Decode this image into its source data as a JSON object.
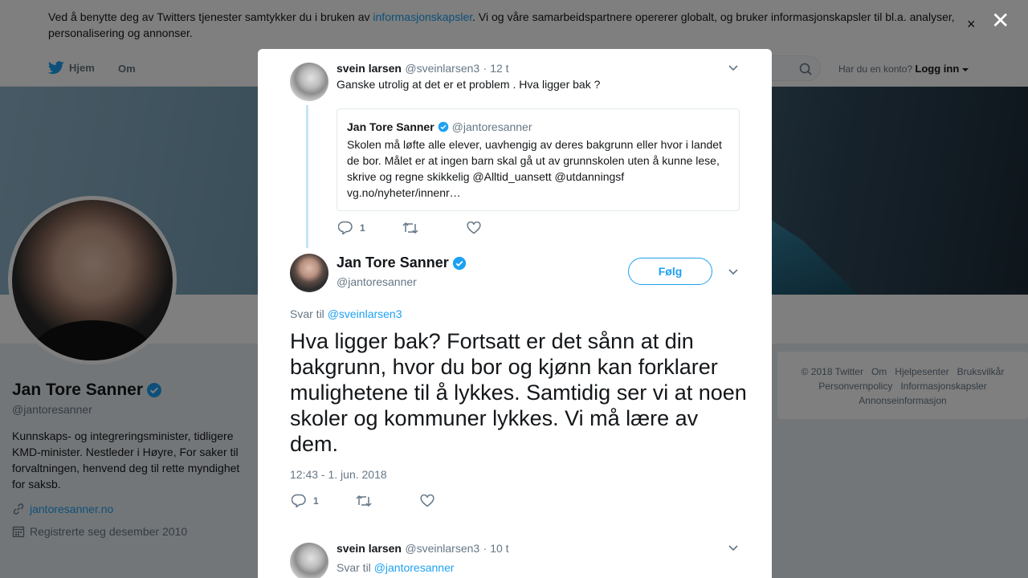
{
  "cookie": {
    "text_before": "Ved å benytte deg av Twitters tjenester samtykker du i bruken av ",
    "link": "informasjonskapsler",
    "text_after": ". Vi og våre samarbeidspartnere opererer globalt, og bruker informasjonskapsler til bl.a. analyser, personalisering og annonser.",
    "close": "×"
  },
  "nav": {
    "home": "Hjem",
    "about": "Om",
    "account_prompt": "Har du en konto?",
    "login": "Logg inn"
  },
  "modal": {
    "close": "✕"
  },
  "profile": {
    "name": "Jan Tore Sanner",
    "handle": "@jantoresanner",
    "bio": "Kunnskaps- og integreringsminister, tidligere KMD-minister. Nestleder i Høyre, For saker til forvaltningen, henvend deg til rette myndighet for saksb.",
    "link": "jantoresanner.no",
    "joined": "Registrerte seg desember 2010"
  },
  "footer": {
    "links": [
      "© 2018 Twitter",
      "Om",
      "Hjelpesenter",
      "Bruksvilkår",
      "Personvernpolicy",
      "Informasjonskapsler",
      "Annonseinformasjon"
    ]
  },
  "parent_tweet": {
    "name": "svein larsen",
    "handle": "@sveinlarsen3",
    "time": "· 12 t",
    "text": "Ganske utrolig at det er et problem . Hva ligger bak ?",
    "quote": {
      "name": "Jan Tore Sanner",
      "handle": "@jantoresanner",
      "text": "Skolen må løfte alle elever, uavhengig av deres bakgrunn eller hvor i landet de bor. Målet er at ingen barn skal gå ut av grunnskolen uten å kunne lese, skrive og regne skikkelig @Alltid_uansett @utdanningsf vg.no/nyheter/innenr…"
    },
    "replies": "1"
  },
  "main_tweet": {
    "name": "Jan Tore Sanner",
    "handle": "@jantoresanner",
    "follow": "Følg",
    "reply_prefix": "Svar til",
    "reply_to": "@sveinlarsen3",
    "text": "Hva ligger bak? Fortsatt er det sånn at din bakgrunn, hvor du bor og kjønn kan forklarer mulighetene til å lykkes. Samtidig ser vi at noen skoler og kommuner lykkes. Vi må lære av dem.",
    "timestamp": "12:43 - 1. jun. 2018",
    "replies": "1"
  },
  "reply_tweet": {
    "name": "svein larsen",
    "handle": "@sveinlarsen3",
    "time": "· 10 t",
    "reply_prefix": "Svar til",
    "reply_to": "@jantoresanner"
  },
  "colors": {
    "accent": "#1da1f2",
    "verified": "#1da1f2",
    "muted": "#657786"
  }
}
